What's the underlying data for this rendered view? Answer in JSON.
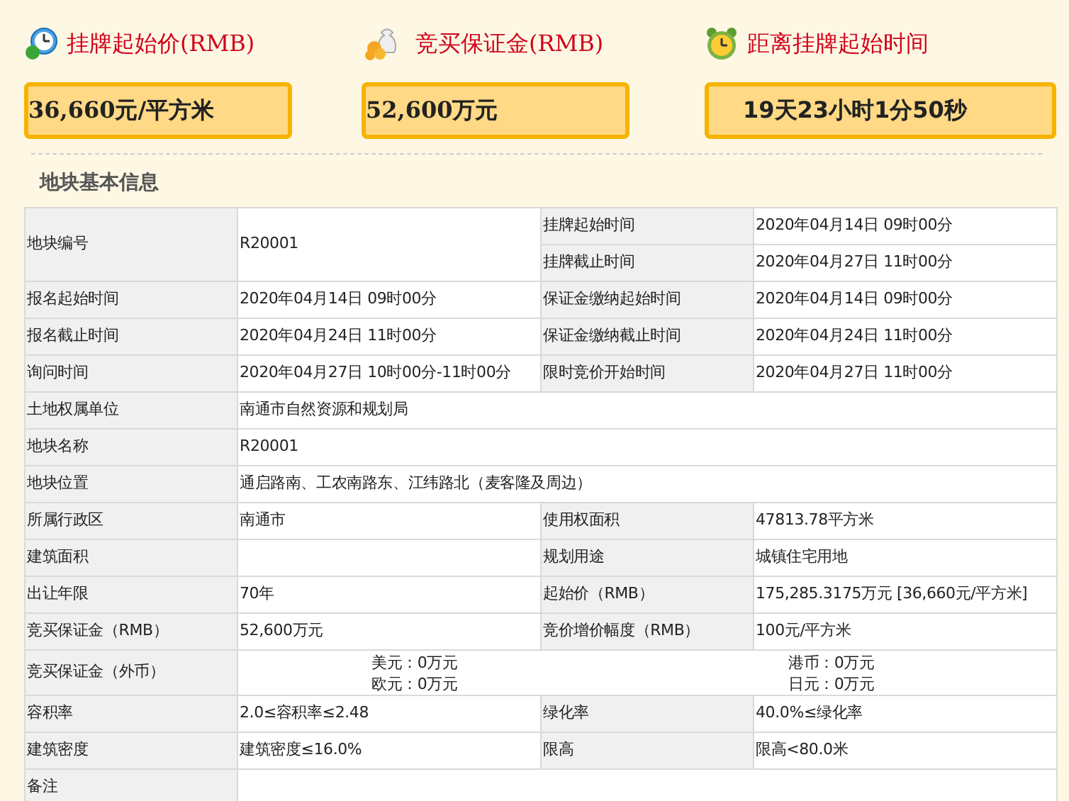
{
  "summary": [
    {
      "kind": "price",
      "title": "挂牌起始价(RMB)",
      "value": "36,660元/平方米"
    },
    {
      "kind": "deposit",
      "title": "竞买保证金(RMB)",
      "value": "52,600万元"
    },
    {
      "kind": "countdown",
      "title": "距离挂牌起始时间",
      "value": "19天23小时1分50秒"
    }
  ],
  "section_title": "地块基本信息",
  "rows": [
    {
      "kind": "double",
      "label": "地块编号",
      "value": "R20001",
      "pairs": [
        {
          "label": "挂牌起始时间",
          "value": "2020年04月14日 09时00分"
        },
        {
          "label": "挂牌截止时间",
          "value": "2020年04月27日 11时00分"
        }
      ]
    },
    {
      "kind": "pair",
      "cells": [
        "报名起始时间",
        "2020年04月14日 09时00分",
        "保证金缴纳起始时间",
        "2020年04月14日 09时00分"
      ]
    },
    {
      "kind": "pair",
      "cells": [
        "报名截止时间",
        "2020年04月24日 11时00分",
        "保证金缴纳截止时间",
        "2020年04月24日 11时00分"
      ]
    },
    {
      "kind": "pair",
      "cells": [
        "询问时间",
        "2020年04月27日 10时00分-11时00分",
        "限时竞价开始时间",
        "2020年04月27日 11时00分"
      ]
    },
    {
      "kind": "wide",
      "cells": [
        "土地权属单位",
        "南通市自然资源和规划局"
      ]
    },
    {
      "kind": "wide",
      "cells": [
        "地块名称",
        "R20001"
      ]
    },
    {
      "kind": "wide",
      "cells": [
        "地块位置",
        "通启路南、工农南路东、江纬路北（麦客隆及周边）"
      ]
    },
    {
      "kind": "pair",
      "cells": [
        "所属行政区",
        "南通市",
        "使用权面积",
        "47813.78平方米"
      ]
    },
    {
      "kind": "pair",
      "cells": [
        "建筑面积",
        "",
        "规划用途",
        "城镇住宅用地"
      ]
    },
    {
      "kind": "pair",
      "cells": [
        "出让年限",
        "70年",
        "起始价（RMB）",
        "175,285.3175万元 [36,660元/平方米]"
      ]
    },
    {
      "kind": "pair",
      "cells": [
        "竞买保证金（RMB）",
        "52,600万元",
        "竞价增价幅度（RMB）",
        "100元/平方米"
      ]
    },
    {
      "kind": "currency",
      "label": "竞买保证金（外币）",
      "lines": [
        [
          "美元：0万元",
          "港币：0万元"
        ],
        [
          "欧元：0万元",
          "日元：0万元"
        ]
      ]
    },
    {
      "kind": "pair",
      "cells": [
        "容积率",
        "2.0≤容积率≤2.48",
        "绿化率",
        "40.0%≤绿化率"
      ]
    },
    {
      "kind": "pair",
      "cells": [
        "建筑密度",
        "建筑密度≤16.0%",
        "限高",
        "限高<80.0米"
      ]
    },
    {
      "kind": "wide",
      "cells": [
        "备注",
        ""
      ]
    }
  ]
}
